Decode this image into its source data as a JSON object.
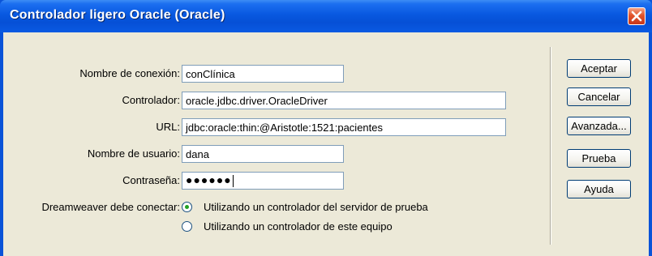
{
  "window": {
    "title": "Controlador ligero Oracle (Oracle)"
  },
  "form": {
    "connection_name": {
      "label": "Nombre de conexión:",
      "value": "conClínica"
    },
    "driver": {
      "label": "Controlador:",
      "value": "oracle.jdbc.driver.OracleDriver"
    },
    "url": {
      "label": "URL:",
      "value": "jdbc:oracle:thin:@Aristotle:1521:pacientes"
    },
    "username": {
      "label": "Nombre de usuario:",
      "value": "dana"
    },
    "password": {
      "label": "Contraseña:",
      "value": "●●●●●●"
    },
    "connect": {
      "label": "Dreamweaver debe conectar:",
      "options": [
        {
          "label": "Utilizando un controlador del servidor de prueba",
          "selected": true
        },
        {
          "label": "Utilizando un controlador de este equipo",
          "selected": false
        }
      ]
    }
  },
  "buttons": {
    "accept": "Aceptar",
    "cancel": "Cancelar",
    "advanced": "Avanzada...",
    "test": "Prueba",
    "help": "Ayuda"
  },
  "colors": {
    "titlebar": "#0858e0",
    "dialog_bg": "#ece9d8",
    "close": "#e2542b",
    "radio_selected": "#21a121"
  },
  "icons": {
    "close": "close-icon"
  }
}
